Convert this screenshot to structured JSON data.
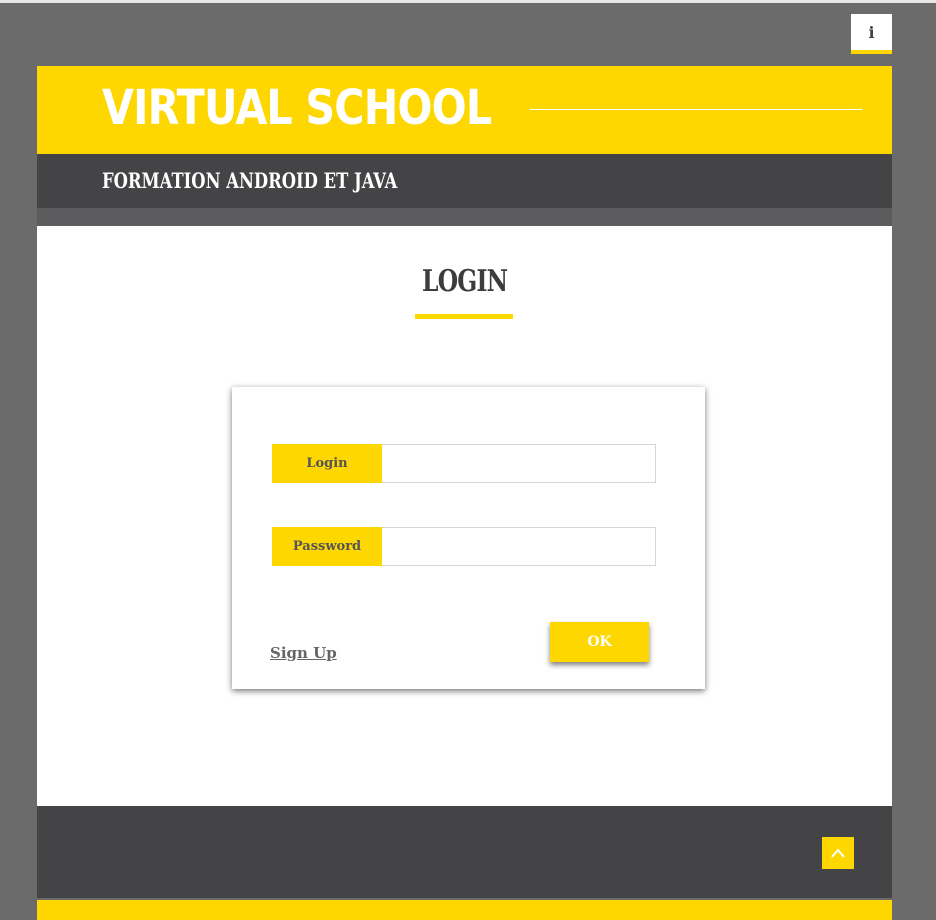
{
  "app": {
    "info_label": "i"
  },
  "header": {
    "brand": "VIRTUAL SCHOOL",
    "subtitle": "FORMATION ANDROID ET JAVA"
  },
  "main": {
    "title": "LOGIN"
  },
  "form": {
    "login_label": "Login",
    "login_value": "",
    "password_label": "Password",
    "password_value": "",
    "signup_link": "Sign Up",
    "ok_label": "OK"
  },
  "footer": {
    "back_to_top_icon": "chevron-up-icon"
  },
  "colors": {
    "accent": "#ffd700",
    "dark": "#444447",
    "background": "#6b6b6b"
  }
}
